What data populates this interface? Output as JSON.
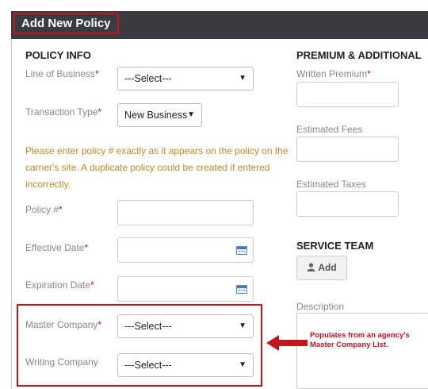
{
  "header": {
    "title": "Add New Policy"
  },
  "policy_info": {
    "section_title": "POLICY INFO",
    "line_of_business": {
      "label": "Line of Business",
      "value": "---Select---"
    },
    "transaction_type": {
      "label": "Transaction Type",
      "value": "New Business"
    },
    "warning": "Please enter policy # exactly as it appears on the policy on the carrier's site. A duplicate policy could be created if entered incorrectly.",
    "policy_number": {
      "label": "Policy #",
      "value": ""
    },
    "effective_date": {
      "label": "Effective Date",
      "value": ""
    },
    "expiration_date": {
      "label": "Expiration Date",
      "value": ""
    },
    "master_company": {
      "label": "Master Company",
      "value": "---Select---"
    },
    "writing_company": {
      "label": "Writing Company",
      "value": "---Select---"
    },
    "required_marker": "*"
  },
  "premium": {
    "section_title": "PREMIUM & ADDITIONAL",
    "written_premium": {
      "label": "Written Premium",
      "value": ""
    },
    "estimated_fees": {
      "label": "Estimated Fees",
      "value": ""
    },
    "estimated_taxes": {
      "label": "Estimated Taxes",
      "value": ""
    }
  },
  "service_team": {
    "section_title": "SERVICE TEAM",
    "add_label": "Add",
    "icon": "person-icon"
  },
  "description": {
    "label": "Description",
    "value": ""
  },
  "annotation": {
    "note": "Populates from an agency's Master Company List."
  },
  "colors": {
    "header_bg": "#393b40",
    "highlight_red": "#c0161c",
    "warning_text": "#c28a2a"
  }
}
